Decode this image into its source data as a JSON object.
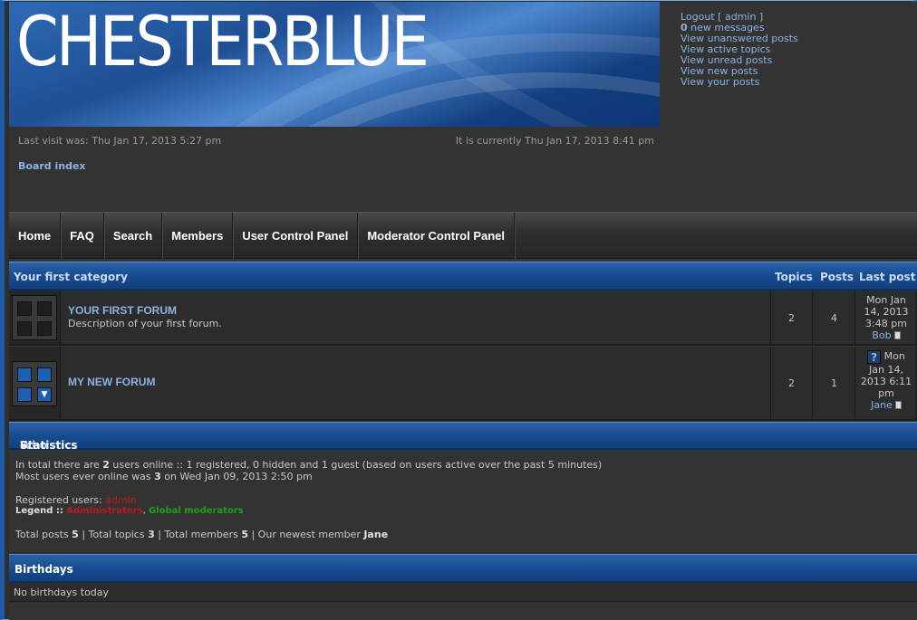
{
  "header": {
    "site_title": "CHESTERBLUE",
    "user_links": {
      "logout": "Logout [ admin ]",
      "new_messages_count": "0",
      "new_messages_label": " new messages",
      "unanswered": "View unanswered posts",
      "active": "View active topics",
      "unread": "View unread posts",
      "new_posts": "View new posts",
      "your_posts": "View your posts"
    },
    "last_visit": "Last visit was: Thu Jan 17, 2013 5:27 pm",
    "current_time": "It is currently Thu Jan 17, 2013 8:41 pm",
    "breadcrumb": "Board index"
  },
  "nav": {
    "items": [
      "Home",
      "FAQ",
      "Search",
      "Members",
      "User Control Panel",
      "Moderator Control Panel"
    ]
  },
  "category": {
    "title": "Your first category",
    "col_topics": "Topics",
    "col_posts": "Posts",
    "col_last": "Last post"
  },
  "forums": [
    {
      "name": "YOUR FIRST FORUM",
      "description": "Description of your first forum.",
      "topics": "2",
      "posts": "4",
      "last_line1": "Mon Jan",
      "last_line2": "14, 2013",
      "last_line3": "3:48 pm",
      "last_user": "Bob"
    },
    {
      "name": "MY NEW FORUM",
      "description": "",
      "topics": "2",
      "posts": "1",
      "last_line1": "Mon",
      "last_line2": "Jan 14,",
      "last_line3": "2013 6:11",
      "last_line4": "pm",
      "last_user": "Jane"
    }
  ],
  "online": {
    "title_a": "Who is online",
    "title_sep": " - ",
    "title_b": "Statistics",
    "line1_a": "In total there are ",
    "line1_count": "2",
    "line1_b": " users online :: 1 registered, 0 hidden and 1 guest (based on users active over the past 5 minutes)",
    "line2_a": "Most users ever online was ",
    "line2_count": "3",
    "line2_b": " on Wed Jan 09, 2013 2:50 pm",
    "registered_label": "Registered users: ",
    "registered_user": "admin",
    "legend_label": "Legend :: ",
    "legend_admins": "Administrators",
    "legend_sep": ", ",
    "legend_mods": "Global moderators",
    "stats_posts_label": "Total posts ",
    "stats_posts": "5",
    "stats_topics_label": " | Total topics ",
    "stats_topics": "3",
    "stats_members_label": " | Total members ",
    "stats_members": "5",
    "stats_newest_label": " | Our newest member ",
    "stats_newest": "Jane"
  },
  "birthdays": {
    "title": "Birthdays",
    "text": "No birthdays today"
  },
  "colors": {
    "accent_blue": "#1c5aa8",
    "link_blue": "#8cb3e4",
    "admin_red": "#c01818",
    "mod_green": "#1aa21a"
  }
}
